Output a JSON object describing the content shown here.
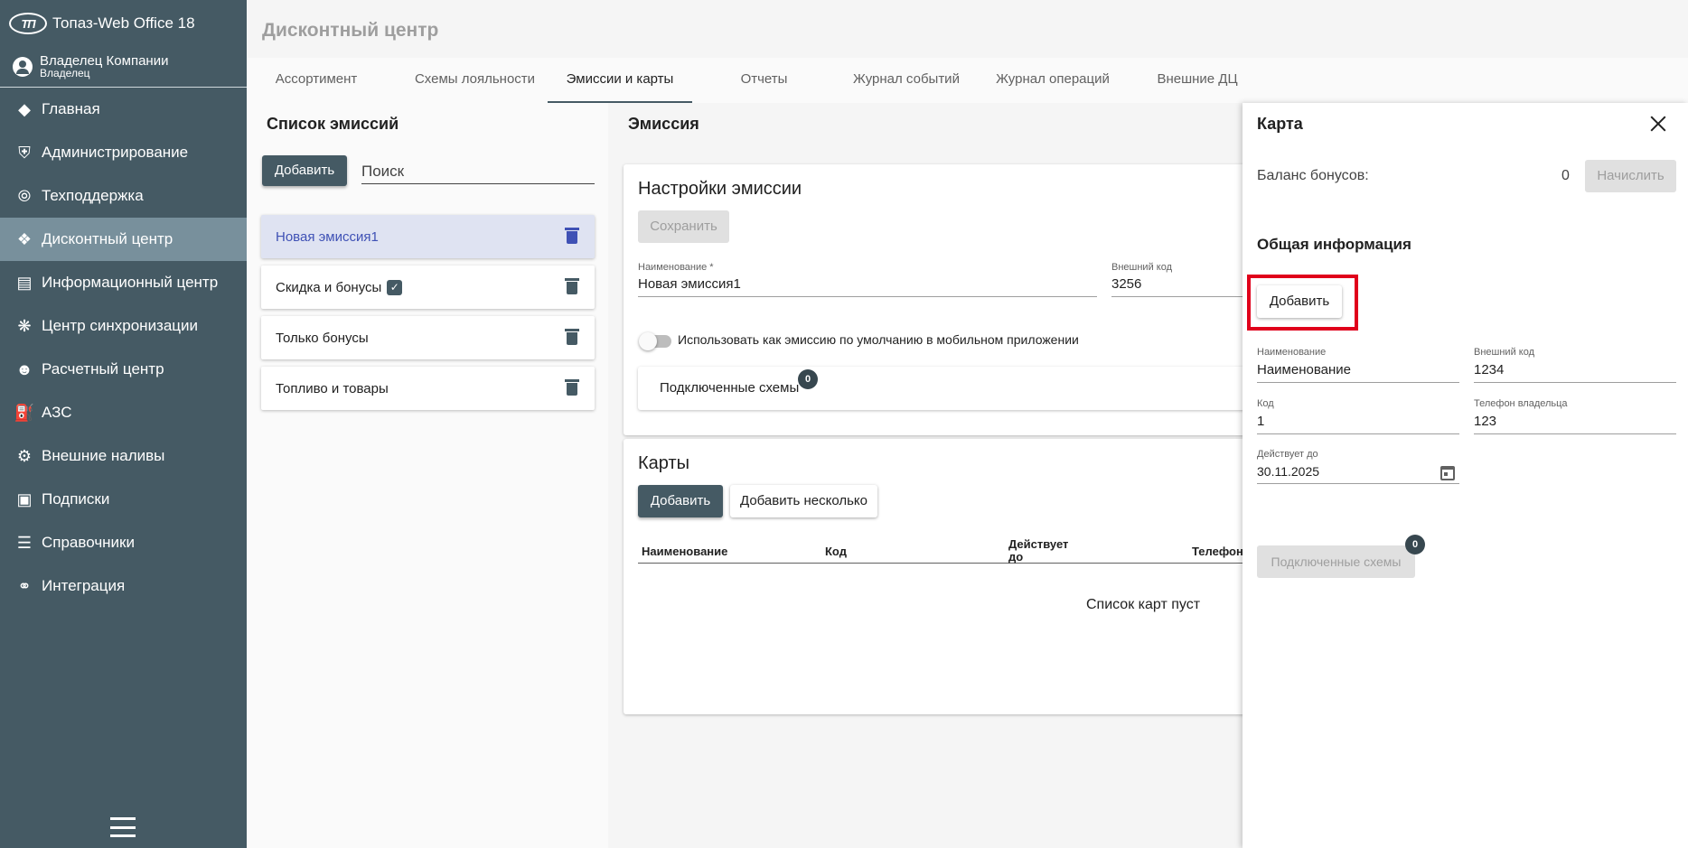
{
  "app": {
    "title": "Топаз-Web Office 18",
    "logo_text": "ТП"
  },
  "user": {
    "name": "Владелец Компании",
    "role": "Владелец"
  },
  "sidebar": {
    "items": [
      {
        "label": "Главная",
        "icon": "gem-icon"
      },
      {
        "label": "Администрирование",
        "icon": "admin-shield-icon"
      },
      {
        "label": "Техподдержка",
        "icon": "lifebuoy-icon"
      },
      {
        "label": "Дисконтный центр",
        "icon": "tag-icon",
        "active": true
      },
      {
        "label": "Информационный центр",
        "icon": "document-icon"
      },
      {
        "label": "Центр синхронизации",
        "icon": "network-icon"
      },
      {
        "label": "Расчетный центр",
        "icon": "people-icon"
      },
      {
        "label": "АЗС",
        "icon": "fuel-pump-icon"
      },
      {
        "label": "Внешние наливы",
        "icon": "gears-icon"
      },
      {
        "label": "Подписки",
        "icon": "subscription-icon"
      },
      {
        "label": "Справочники",
        "icon": "book-icon"
      },
      {
        "label": "Интеграция",
        "icon": "integration-icon"
      }
    ]
  },
  "page": {
    "title": "Дисконтный центр"
  },
  "tabs": [
    {
      "label": "Ассортимент"
    },
    {
      "label": "Схемы лояльности"
    },
    {
      "label": "Эмиссии и карты",
      "active": true
    },
    {
      "label": "Отчеты"
    },
    {
      "label": "Журнал событий"
    },
    {
      "label": "Журнал операций"
    },
    {
      "label": "Внешние ДЦ"
    }
  ],
  "emission_list": {
    "title": "Список эмиссий",
    "add_label": "Добавить",
    "search_placeholder": "Поиск",
    "items": [
      {
        "label": "Новая эмиссия1",
        "selected": true
      },
      {
        "label": "Скидка и бонусы",
        "checked": true
      },
      {
        "label": "Только бонусы"
      },
      {
        "label": "Топливо и товары"
      }
    ]
  },
  "emission": {
    "title": "Эмиссия",
    "settings": {
      "title": "Настройки эмиссии",
      "save_label": "Сохранить",
      "name_label": "Наименование *",
      "name_value": "Новая эмиссия1",
      "ext_code_label": "Внешний код",
      "ext_code_value": "3256",
      "toggle_label": "Использовать как эмиссию по умолчанию в мобильном приложении",
      "schemes_label": "Подключенные схемы",
      "schemes_count": "0"
    },
    "cards": {
      "title": "Карты",
      "add_label": "Добавить",
      "add_many_label": "Добавить несколько",
      "columns": [
        "Наименование",
        "Код",
        "Действует до",
        "Телефон"
      ],
      "empty_text": "Список карт пуст"
    }
  },
  "card_panel": {
    "title": "Карта",
    "balance_label": "Баланс бонусов:",
    "balance_value": "0",
    "accrue_label": "Начислить",
    "general_title": "Общая информация",
    "add_label": "Добавить",
    "fields": {
      "name_label": "Наименование",
      "name_value": "Наименование",
      "ext_code_label": "Внешний код",
      "ext_code_value": "1234",
      "code_label": "Код",
      "code_value": "1",
      "phone_label": "Телефон владельца",
      "phone_value": "123",
      "valid_label": "Действует до",
      "valid_value": "30.11.2025"
    },
    "schemes_label": "Подключенные схемы",
    "schemes_count": "0"
  },
  "colors": {
    "sidebar_bg": "#455a64",
    "sidebar_active": "#78909c",
    "primary": "#455a64",
    "selected_text": "#3f51b5",
    "highlight": "#e0001b"
  }
}
